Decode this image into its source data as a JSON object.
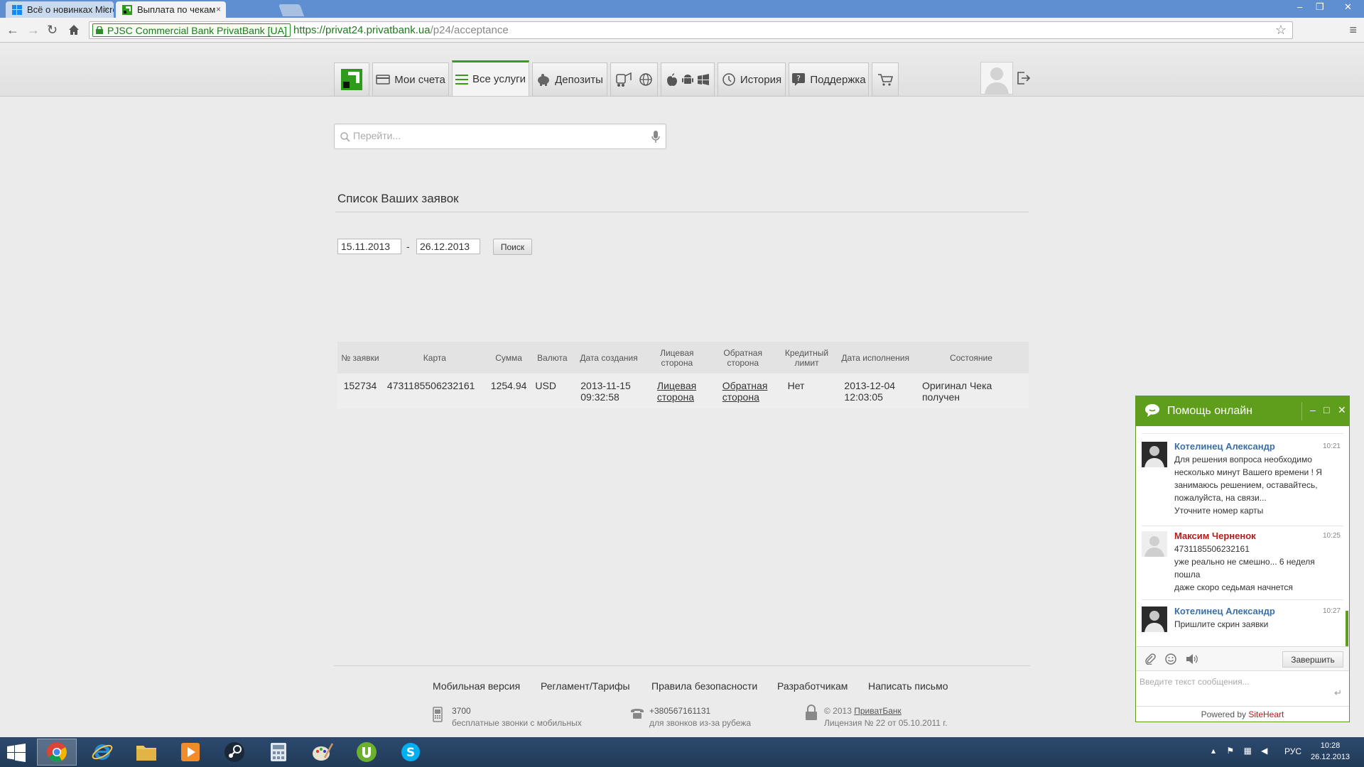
{
  "browser": {
    "tabs": [
      {
        "title": "Всё о новинках Microsoft",
        "close": "×"
      },
      {
        "title": "Выплата по чекам",
        "close": "×"
      }
    ],
    "window_controls": {
      "minimize": "–",
      "restore": "❐",
      "close": "✕"
    },
    "ev_label": "PJSC Commercial Bank PrivatBank [UA]",
    "url_scheme": "https://",
    "url_host": "privat24.privatbank.ua",
    "url_path": "/p24/acceptance"
  },
  "nav": {
    "items": [
      {
        "label": "Мои счета"
      },
      {
        "label": "Все услуги"
      },
      {
        "label": "Депозиты"
      },
      {
        "label": "История"
      },
      {
        "label": "Поддержка"
      }
    ]
  },
  "search": {
    "placeholder": "Перейти..."
  },
  "requests": {
    "title": "Список Ваших заявок",
    "date_from": "15.11.2013",
    "date_sep": "-",
    "date_to": "26.12.2013",
    "search_button": "Поиск",
    "columns": [
      "№ заявки",
      "Карта",
      "Сумма",
      "Валюта",
      "Дата создания",
      "Лицевая сторона",
      "Обратная сторона",
      "Кредитный лимит",
      "Дата исполнения",
      "Состояние"
    ],
    "rows": [
      {
        "id": "152734",
        "card": "4731185506232161",
        "amount": "1254.94",
        "currency": "USD",
        "created": "2013-11-15 09:32:58",
        "front": "Лицевая сторона",
        "back": "Обратная сторона",
        "credit_limit": "Нет",
        "executed": "2013-12-04 12:03:05",
        "status": "Оригинал Чека получен"
      }
    ]
  },
  "footer": {
    "links": [
      "Мобильная версия",
      "Регламент/Тарифы",
      "Правила безопасности",
      "Разработчикам",
      "Написать письмо"
    ],
    "phone_short": "3700",
    "phone_short_note": "бесплатные звонки с мобильных",
    "phone_intl": "+380567161131",
    "phone_intl_note": "для звонков из-за рубежа",
    "copyright": "© 2013",
    "copyright_link": "ПриватБанк",
    "license": "Лицензия № 22 от 05.10.2011 г."
  },
  "chat": {
    "title": "Помощь онлайн",
    "controls": {
      "minimize": "–",
      "maximize": "□",
      "close": "✕"
    },
    "messages": [
      {
        "author": "Котелинец Александр",
        "time": "10:21",
        "text": "Для решения вопроса необходимо несколько минут Вашего времени ! Я занимаюсь решением, оставайтесь, пожалуйста, на связи...\nУточните номер карты"
      },
      {
        "author": "Максим Черненок",
        "time": "10:25",
        "text": "4731185506232161\nуже реально не смешно... 6 неделя пошла\nдаже скоро седьмая начнется"
      },
      {
        "author": "Котелинец Александр",
        "time": "10:27",
        "text": "Пришлите скрин заявки"
      }
    ],
    "end_button": "Завершить",
    "input_placeholder": "Введите текст сообщения...",
    "send_glyph": "↵",
    "powered_prefix": "Powered by ",
    "powered_site": "Site",
    "powered_brand": "Heart"
  },
  "taskbar": {
    "language": "РУС",
    "time": "10:28",
    "date": "26.12.2013"
  },
  "colors": {
    "accent_green": "#5f9e1c",
    "nav_active": "#3d9a18",
    "agent_name": "#3a6ea5",
    "client_name": "#b21e1e"
  }
}
